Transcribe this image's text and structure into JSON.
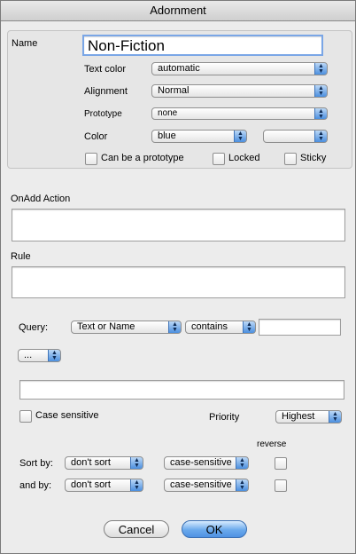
{
  "window": {
    "title": "Adornment"
  },
  "name": {
    "label": "Name",
    "value": "Non-Fiction"
  },
  "text_color": {
    "label": "Text color",
    "value": "automatic"
  },
  "alignment": {
    "label": "Alignment",
    "value": "Normal"
  },
  "prototype": {
    "label": "Prototype",
    "value": "none"
  },
  "color": {
    "label": "Color",
    "value": "blue",
    "secondary_value": ""
  },
  "checkboxes": {
    "can_be_prototype": "Can be a prototype",
    "locked": "Locked",
    "sticky": "Sticky"
  },
  "onadd": {
    "label": "OnAdd Action",
    "value": ""
  },
  "rule": {
    "label": "Rule",
    "value": ""
  },
  "query": {
    "label": "Query:",
    "field": "Text or Name",
    "operator": "contains",
    "value": "",
    "extra": "...",
    "expression": ""
  },
  "case_sensitive": {
    "label": "Case sensitive"
  },
  "priority": {
    "label": "Priority",
    "value": "Highest"
  },
  "sort": {
    "reverse_label": "reverse",
    "sort_by_label": "Sort by:",
    "sort_by_value": "don't sort",
    "sort_by_case": "case-sensitive",
    "and_by_label": "and by:",
    "and_by_value": "don't sort",
    "and_by_case": "case-sensitive"
  },
  "buttons": {
    "cancel": "Cancel",
    "ok": "OK"
  },
  "icons": {
    "popup_arrow": "up-down-arrows-icon"
  }
}
